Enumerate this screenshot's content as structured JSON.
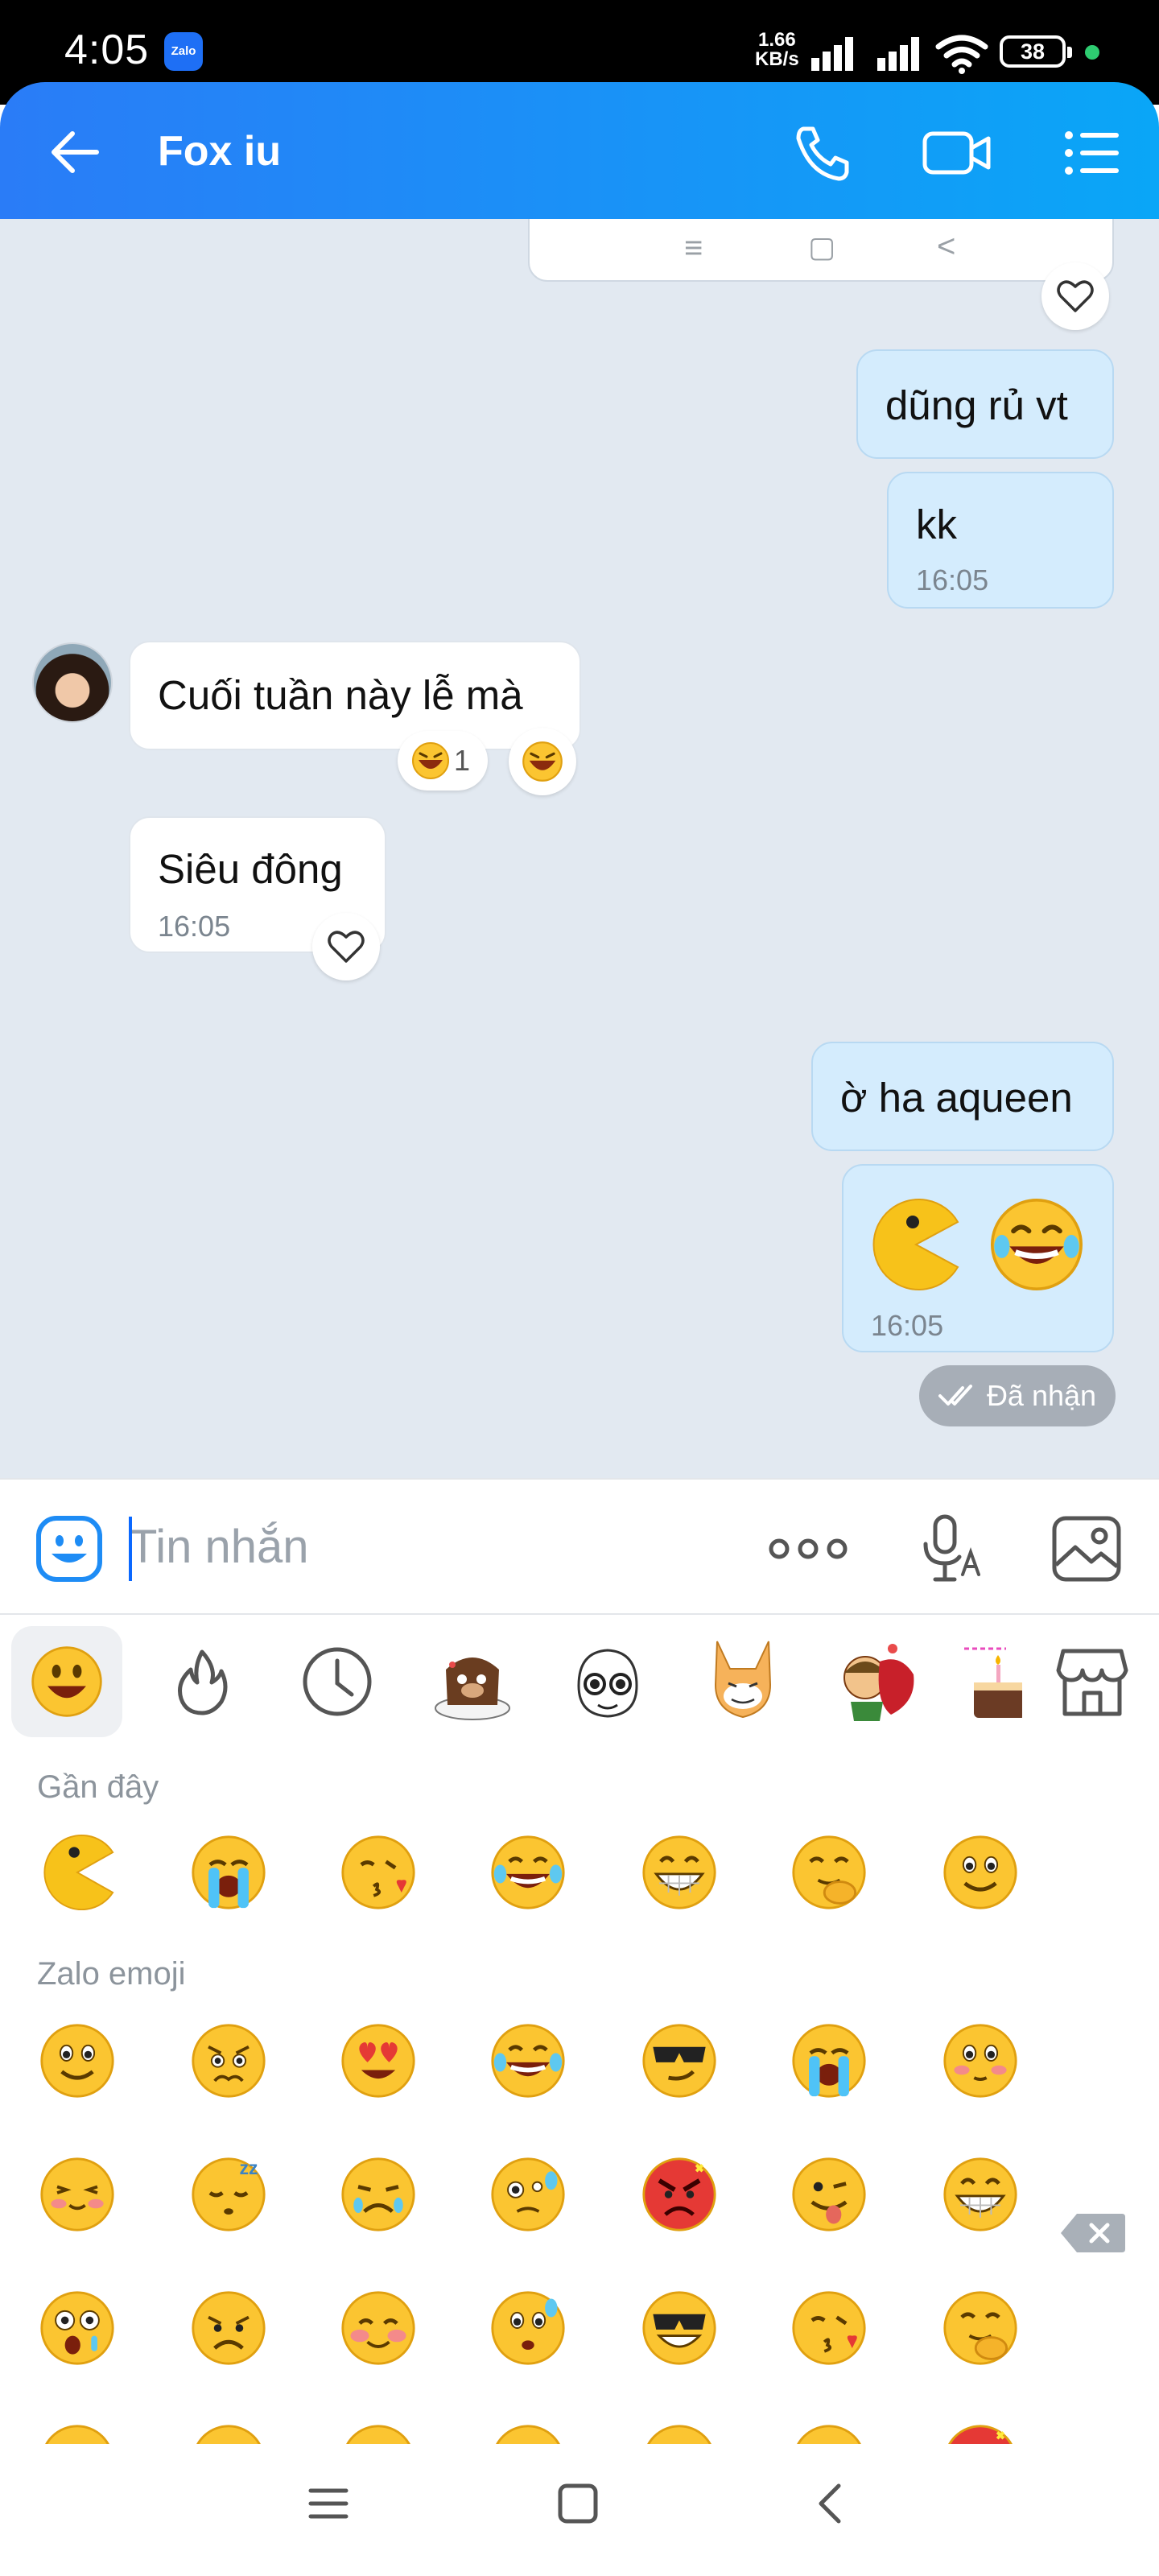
{
  "status_bar": {
    "time": "4:05",
    "app_badge": "Zalo",
    "net_speed_value": "1.66",
    "net_speed_unit": "KB/s",
    "battery": "38"
  },
  "header": {
    "title": "Fox iu",
    "icons": [
      "back-arrow-icon",
      "phone-icon",
      "video-call-icon",
      "menu-list-icon"
    ]
  },
  "screenshot_nav_glyphs": [
    "≡",
    "▢",
    "<"
  ],
  "messages": [
    {
      "side": "out",
      "text": "dũng rủ vt"
    },
    {
      "side": "out",
      "text": "kk",
      "time": "16:05"
    },
    {
      "side": "in",
      "text": "Cuối tuần này lễ mà",
      "reaction_count": "1"
    },
    {
      "side": "in",
      "text": "Siêu đông",
      "time": "16:05"
    },
    {
      "side": "out",
      "text": "ờ ha aqueen"
    },
    {
      "side": "out",
      "emojis": [
        "pacman",
        "laughing-tears"
      ],
      "time": "16:05"
    }
  ],
  "delivery_status": "Đã nhận",
  "composer": {
    "placeholder": "Tin nhắn",
    "icons": [
      "emoji-face-icon",
      "more-dots-icon",
      "voice-to-text-icon",
      "image-icon"
    ]
  },
  "emoji_panel": {
    "tabs": [
      "smiley",
      "fire",
      "recent-clock",
      "sticker-dog",
      "sticker-mochi",
      "sticker-fox",
      "sticker-couple",
      "sticker-birthday",
      "sticker-store"
    ],
    "recent_title": "Gần đây",
    "recent": [
      "pacman",
      "crying",
      "kiss-heart",
      "laughing-tears",
      "big-grin",
      "giggle",
      "smile"
    ],
    "zalo_title": "Zalo emoji",
    "zalo_rows": [
      [
        "smile",
        "worried",
        "heart-eyes",
        "laughing-tears",
        "sunglasses-smirk",
        "crying",
        "blush-eyes"
      ],
      [
        "blush",
        "sleepy",
        "tearful-frown",
        "sweat-confused",
        "angry",
        "tongue-wink",
        "big-grin"
      ],
      [
        "shocked",
        "sad",
        "shy",
        "anxious-sweat",
        "sunglasses-grin",
        "kiss-heart",
        "giggle"
      ]
    ]
  },
  "colors": {
    "header_start": "#2a7cf7",
    "header_end": "#0aa6f7",
    "chat_bg": "#e2e9f1",
    "outgoing_bubble": "#d4ecfd",
    "incoming_bubble": "#ffffff",
    "accent": "#0a68ff"
  }
}
